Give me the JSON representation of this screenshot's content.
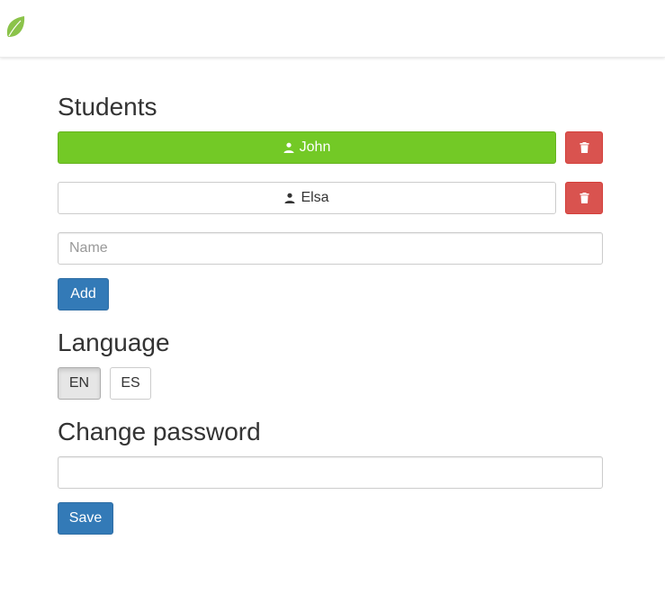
{
  "header": {
    "logo_icon": "leaf-icon",
    "logo_color": "#8bc34a"
  },
  "students": {
    "title": "Students",
    "items": [
      {
        "name": "John",
        "icon": "user-icon",
        "active": true
      },
      {
        "name": "Elsa",
        "icon": "user-icon",
        "active": false
      }
    ],
    "delete_icon": "trash-icon",
    "name_placeholder": "Name",
    "name_value": "",
    "add_label": "Add"
  },
  "language": {
    "title": "Language",
    "options": [
      "EN",
      "ES"
    ],
    "selected": "EN"
  },
  "password": {
    "title": "Change password",
    "value": "",
    "save_label": "Save"
  },
  "colors": {
    "active_student": "#73c926",
    "delete": "#d9534f",
    "primary": "#337ab7"
  }
}
